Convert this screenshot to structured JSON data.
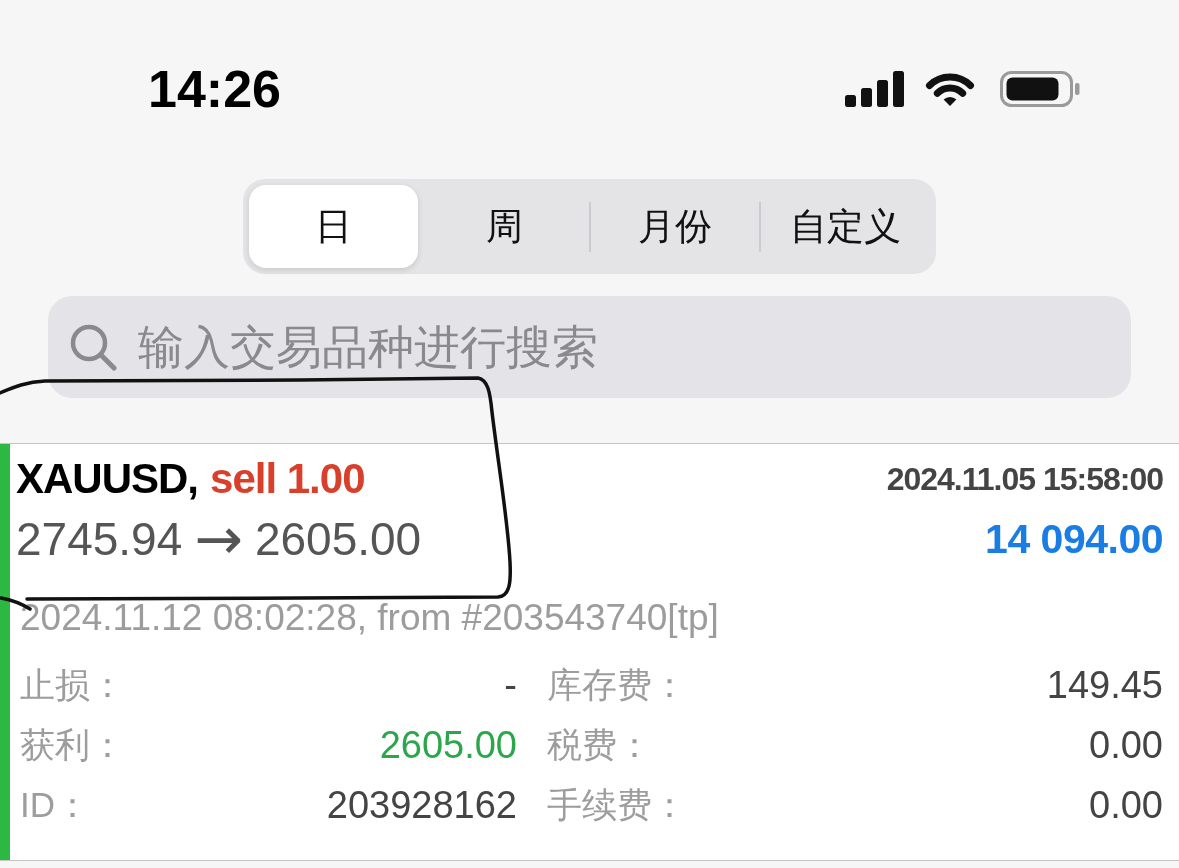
{
  "status_bar": {
    "time": "14:26"
  },
  "period_tabs": [
    {
      "label": "日",
      "selected": true
    },
    {
      "label": "周",
      "selected": false
    },
    {
      "label": "月份",
      "selected": false
    },
    {
      "label": "自定义",
      "selected": false
    }
  ],
  "search": {
    "placeholder": "输入交易品种进行搜索"
  },
  "deals": [
    {
      "color": "#2db843",
      "symbol": "XAUUSD,",
      "order": "sell 1.00",
      "open_time": "2024.11.05 15:58:00",
      "open_price": "2745.94",
      "arrow": "→",
      "close_price": "2605.00",
      "profit": "14 094.00",
      "close_info": "2024.11.12 08:02:28, from #203543740[tp]",
      "detail_rows": [
        {
          "left": {
            "label": "止损：",
            "value": "-",
            "color": "#444444"
          },
          "right": {
            "label": "库存费：",
            "value": "149.45",
            "color": "#444444"
          }
        },
        {
          "left": {
            "label": "获利：",
            "value": "2605.00",
            "color": "#2ba64a"
          },
          "right": {
            "label": "税费：",
            "value": "0.00",
            "color": "#444444"
          }
        },
        {
          "left": {
            "label": "ID：",
            "value": "203928162",
            "color": "#444444"
          },
          "right": {
            "label": "手续费：",
            "value": "0.00",
            "color": "#444444"
          }
        }
      ]
    }
  ]
}
